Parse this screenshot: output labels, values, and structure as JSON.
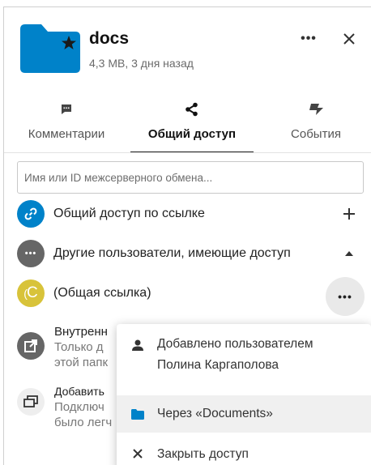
{
  "header": {
    "title": "docs",
    "subtitle": "4,3 MB, 3 дня назад",
    "menu_icon": "dots-horizontal-icon",
    "close_icon": "close-icon",
    "folder_color": "#0082c9"
  },
  "tabs": [
    {
      "label": "Комментарии",
      "icon": "comment-icon",
      "active": false
    },
    {
      "label": "Общий доступ",
      "icon": "share-icon",
      "active": true
    },
    {
      "label": "События",
      "icon": "activity-icon",
      "active": false
    }
  ],
  "search": {
    "placeholder": "Имя или ID межсерверного обмена..."
  },
  "rows": {
    "share_link": {
      "label": "Общий доступ по ссылке",
      "action": "+",
      "avatar_color": "#0082c9"
    },
    "others": {
      "label": "Другие пользователи, имеющие доступ",
      "avatar_color": "#666666"
    },
    "public_link": {
      "label": "(Общая ссылка)",
      "avatar_letter": "C",
      "avatar_color": "#d8c33a"
    },
    "internal": {
      "title": "Внутренн",
      "line1": "Только д",
      "line2": "этой папк"
    },
    "add": {
      "title": "Добавить",
      "line1": "Подключ",
      "line2": "было легч"
    }
  },
  "popover": {
    "added_by": "Добавлено пользователем",
    "added_by_user": "Полина Каргаполова",
    "via": "Через «Documents»",
    "unshare": "Закрыть доступ"
  }
}
